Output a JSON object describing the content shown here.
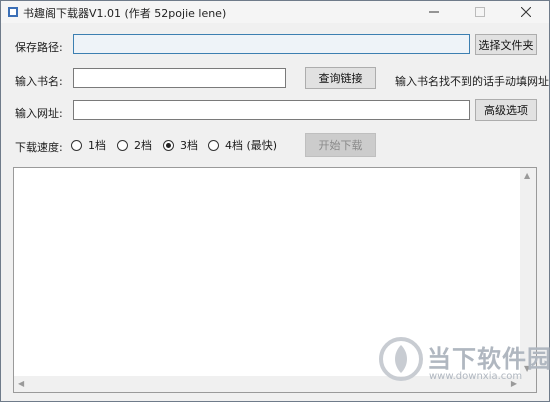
{
  "window": {
    "title": "书趣阁下载器V1.01 (作者 52pojie lene)"
  },
  "form": {
    "save_path_label": "保存路径:",
    "save_path_value": "",
    "choose_folder_button": "选择文件夹",
    "book_name_label": "输入书名:",
    "book_name_value": "",
    "query_link_button": "查询链接",
    "hint_text": "输入书名找不到的话手动填网址",
    "url_label": "输入网址:",
    "url_value": "",
    "advanced_button": "高级选项",
    "speed_label": "下载速度:",
    "speed_options": [
      "1档",
      "2档",
      "3档",
      "4档 (最快)"
    ],
    "speed_selected": "3档",
    "start_button": "开始下载"
  },
  "log": {
    "content": ""
  },
  "watermark": {
    "name": "当下软件园",
    "url": "www.downxia.com"
  },
  "icons": {
    "app": "app-icon",
    "minimize": "minimize-icon",
    "maximize": "maximize-icon",
    "close": "close-icon"
  },
  "colors": {
    "focused_field": "#3c7fb1",
    "disabled_button": "#cccccc"
  }
}
